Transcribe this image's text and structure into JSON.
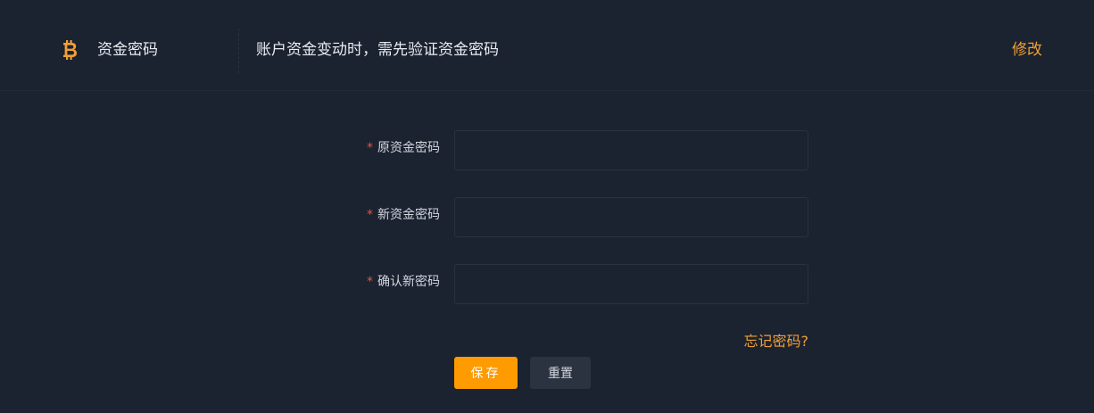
{
  "section": {
    "title": "资金密码",
    "description": "账户资金变动时，需先验证资金密码",
    "edit_label": "修改",
    "icon": "bitcoin-icon",
    "accent_color": "#f0a033"
  },
  "form": {
    "required_mark": "*",
    "fields": [
      {
        "label": "原资金密码",
        "value": "",
        "placeholder": ""
      },
      {
        "label": "新资金密码",
        "value": "",
        "placeholder": ""
      },
      {
        "label": "确认新密码",
        "value": "",
        "placeholder": ""
      }
    ],
    "forgot_label": "忘记密码?",
    "save_label": "保存",
    "reset_label": "重置"
  }
}
